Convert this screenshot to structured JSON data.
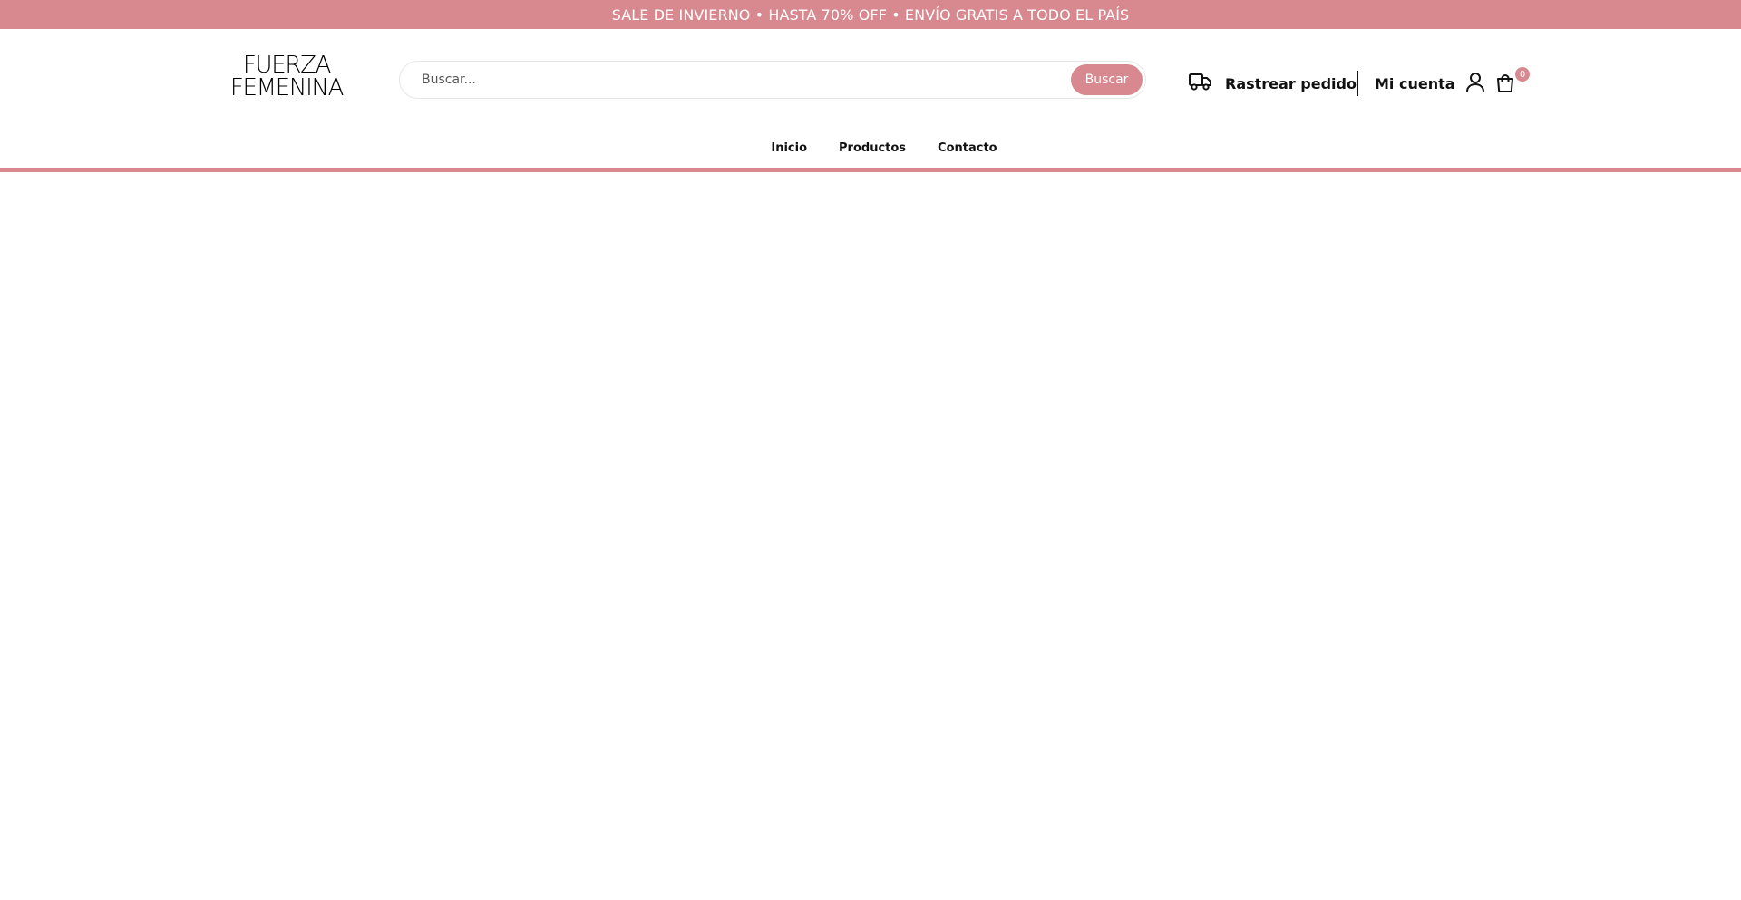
{
  "colors": {
    "accent": "#d8898f",
    "text": "#111111",
    "background": "#ffffff"
  },
  "announcement": {
    "text": "SALE DE INVIERNO • HASTA 70% OFF • ENVÍO GRATIS A TODO EL PAÍS"
  },
  "logo": {
    "line1": "FUERZA",
    "line2": "FEMENINA"
  },
  "search": {
    "placeholder": "Buscar...",
    "value": "",
    "button_label": "Buscar"
  },
  "header": {
    "track_label": "Rastrear pedido",
    "track_icon": "truck-icon",
    "account_label": "Mi cuenta",
    "account_icon": "user-icon",
    "cart_icon": "shopping-bag-icon",
    "cart_count": "0"
  },
  "nav": {
    "items": [
      {
        "label": "Inicio"
      },
      {
        "label": "Productos"
      },
      {
        "label": "Contacto"
      }
    ]
  }
}
